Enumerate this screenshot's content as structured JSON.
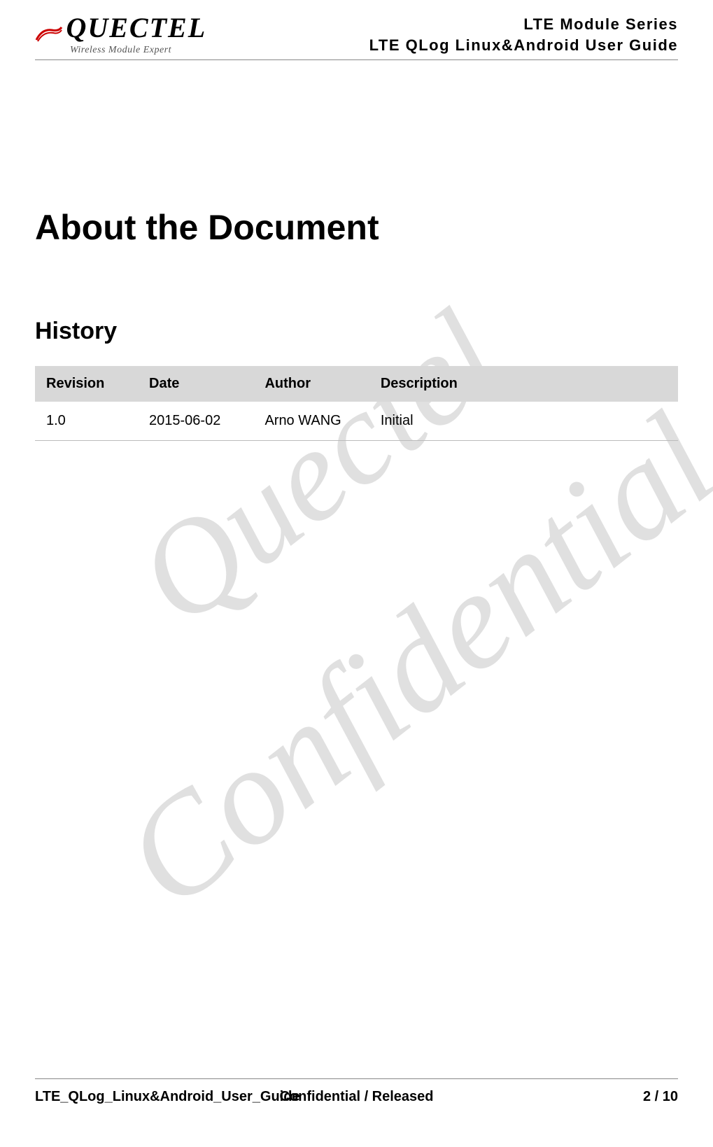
{
  "header": {
    "logo_main": "QUECTEL",
    "logo_sub": "Wireless Module Expert",
    "series": "LTE  Module  Series",
    "guide": "LTE  QLog  Linux&Android  User  Guide"
  },
  "content": {
    "page_title": "About the Document",
    "section_title": "History",
    "table": {
      "headers": {
        "revision": "Revision",
        "date": "Date",
        "author": "Author",
        "description": "Description"
      },
      "rows": [
        {
          "revision": "1.0",
          "date": "2015-06-02",
          "author": "Arno WANG",
          "description": "Initial"
        }
      ]
    }
  },
  "watermarks": {
    "wm1": "Quectel",
    "wm2": "Confidential"
  },
  "footer": {
    "left": "LTE_QLog_Linux&Android_User_Guide",
    "center": "Confidential / Released",
    "right": "2 / 10"
  }
}
